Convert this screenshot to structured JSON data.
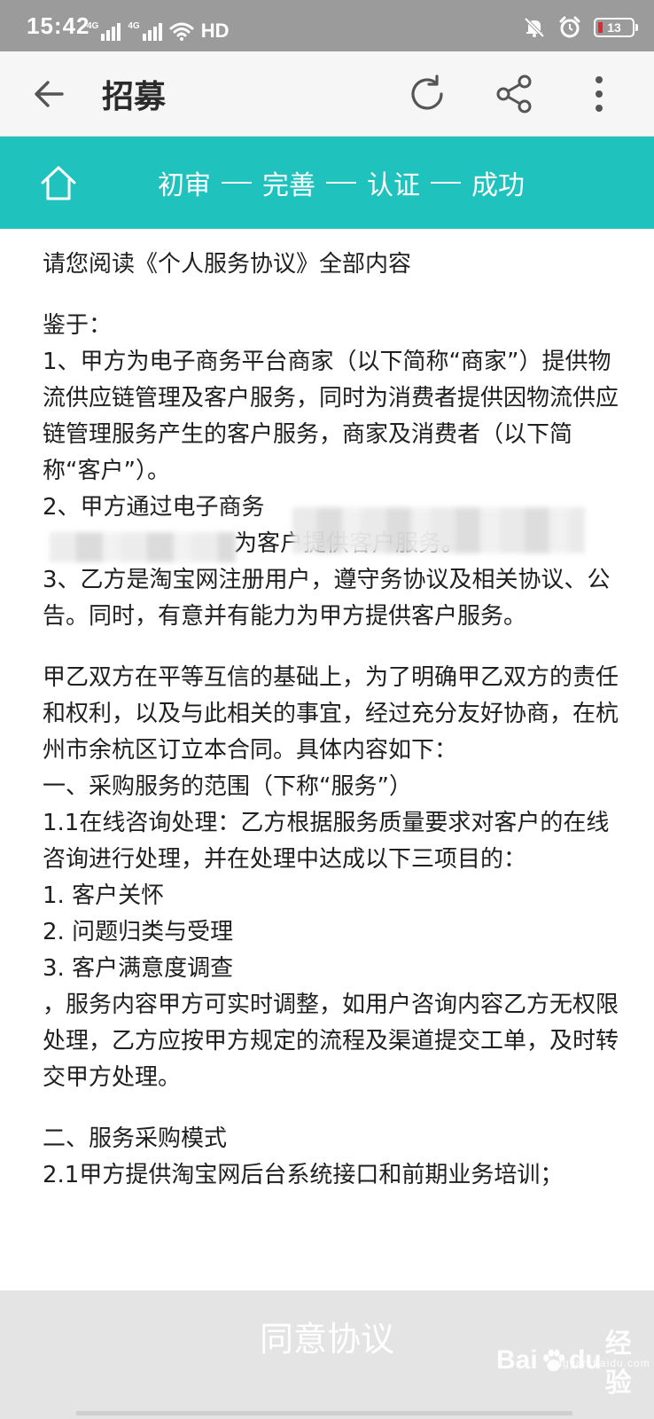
{
  "status_bar": {
    "time": "15:42",
    "network_1": "4G",
    "network_2": "4G",
    "hd": "HD",
    "battery": "13",
    "icons": [
      "signal-icon",
      "signal-icon",
      "wifi-icon",
      "mute-icon",
      "alarm-icon",
      "battery-icon"
    ]
  },
  "header": {
    "title": "招募",
    "icons": [
      "back-arrow-icon",
      "refresh-icon",
      "share-icon",
      "more-vertical-icon"
    ]
  },
  "steps": {
    "items": [
      "初审",
      "完善",
      "认证",
      "成功"
    ],
    "icon": "home-icon",
    "background": "#1fc2bd"
  },
  "content": {
    "intro": "请您阅读《个人服务协议》全部内容",
    "whereas": "鉴于：",
    "p1": "1、甲方为电子商务平台商家（以下简称“商家”）提供物流供应链管理及客户服务，同时为消费者提供因物流供应链管理服务产生的客户服务，商家及消费者（以下简称“客户”）。",
    "p2a": "2、甲方通过电子商务",
    "p2b": "为客户提供客户服务。",
    "p3": "3、乙方是淘宝网注册用户，遵守务协议及相关协议、公告。同时，有意并有能力为甲方提供客户服务。",
    "p4": "甲乙双方在平等互信的基础上，为了明确甲乙双方的责任和权利，以及与此相关的事宜，经过充分友好协商，在杭州市余杭区订立本合同。具体内容如下：",
    "s1": "一、采购服务的范围（下称“服务”）",
    "s1_1": "1.1在线咨询处理：乙方根据服务质量要求对客户的在线咨询进行处理，并在处理中达成以下三项目的：",
    "item1": "1. 客户关怀",
    "item2": "2. 问题归类与受理",
    "item3": "3. 客户满意度调查",
    "p5": "，服务内容甲方可实时调整，如用户咨询内容乙方无权限处理，乙方应按甲方规定的流程及渠道提交工单，及时转交甲方处理。",
    "s2": "二、服务采购模式",
    "s2_1": "2.1甲方提供淘宝网后台系统接口和前期业务培训；"
  },
  "footer": {
    "agree_label": "同意协议",
    "watermark_brand": "Bai du",
    "watermark_cn": "经验",
    "watermark_url": "jingyan.baidu.com"
  }
}
